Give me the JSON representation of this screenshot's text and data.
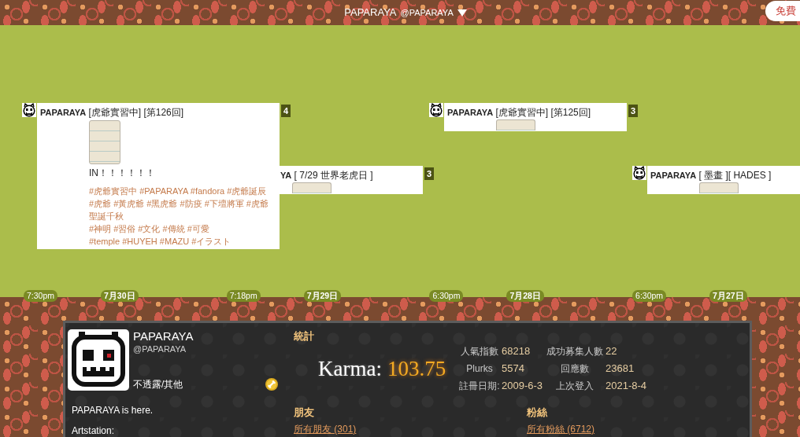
{
  "top_bar": {
    "display_name": "PAPARAYA",
    "handle": "@PAPARAYA",
    "signup_button": "免費"
  },
  "timeline": {
    "plurks": [
      {
        "kind": "expanded",
        "author": "PAPARAYA",
        "content": "[虎爺實習中] [第126回]",
        "response_count": "4",
        "text": "IN！！！！！！",
        "hashtag_lines": [
          "#虎爺實習中 #PAPARAYA #fandora #虎爺誕辰",
          "#虎爺 #黃虎爺 #黑虎爺 #防疫 #下壇將軍 #虎爺",
          "聖誕千秋",
          "#神明 #習俗 #文化 #傳統 #可愛",
          "#temple #HUYEH #MAZU #イラスト"
        ]
      },
      {
        "kind": "overlapped",
        "author": "YA",
        "content": "[ 7/29 世界老虎日 ]",
        "response_count": "3"
      },
      {
        "kind": "collapsed",
        "author": "PAPARAYA",
        "content": "[虎爺實習中] [第125回]",
        "response_count": "3"
      },
      {
        "kind": "collapsed",
        "author": "PAPARAYA",
        "content": "[ 墨畫 ][ HADES ]"
      }
    ],
    "axis": [
      {
        "time": "7:30pm",
        "date": "7月30日"
      },
      {
        "time": "7:18pm",
        "date": "7月29日"
      },
      {
        "time": "6:30pm",
        "date": "7月28日"
      },
      {
        "time": "6:30pm",
        "date": "7月27日"
      }
    ]
  },
  "profile": {
    "display_name": "PAPARAYA",
    "handle": "@PAPARAYA",
    "gender": "不透露/其他",
    "about_lines": [
      "PAPARAYA is here.",
      "Artstation:"
    ],
    "stats": {
      "title": "統計",
      "karma_label": "Karma:",
      "karma_value": "103.75",
      "rows": [
        [
          {
            "label": "人氣指數",
            "value": "68218"
          },
          {
            "label": "成功募集人數",
            "value": "22"
          }
        ],
        [
          {
            "label": "Plurks",
            "value": "5574"
          },
          {
            "label": "回應數",
            "value": "23681"
          }
        ],
        [
          {
            "label": "註冊日期:",
            "value": "2009-6-3"
          },
          {
            "label": "上次登入",
            "value": "2021-8-4"
          }
        ]
      ]
    },
    "friends": {
      "title": "朋友",
      "link": "所有朋友 (301)"
    },
    "fans": {
      "title": "粉絲",
      "link": "所有粉絲 (6712)"
    }
  }
}
